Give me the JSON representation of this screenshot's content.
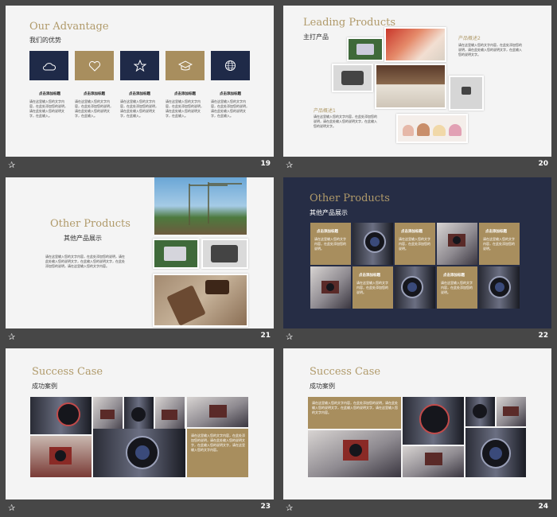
{
  "slides": [
    {
      "number": "19",
      "title": "Our Advantage",
      "subtitle": "我们的优势",
      "icons": [
        "cloud-icon",
        "heart-icon",
        "star-icon",
        "graduation-cap-icon",
        "globe-icon"
      ],
      "column_title": "点击添加标题",
      "body": "请在这里输入您的文字内容，在此处添加您的说明，请在此处输入您的说明文字，在此输入。"
    },
    {
      "number": "20",
      "title": "Leading Products",
      "subtitle": "主打产品",
      "label1": "产品概述2",
      "label2": "产品概述1",
      "body": "请在这里输入您的文字内容，在此处添加您的说明，请在此处输入您的说明文字，在此输入您的说明文字。"
    },
    {
      "number": "21",
      "title": "Other Products",
      "subtitle": "其他产品展示",
      "body": "请在这里输入您的文字内容，在此处添加您的说明，请在此处输入您的说明文字，在此输入您的说明文字，在此处添加您的说明，请在这里输入您的文字内容。"
    },
    {
      "number": "22",
      "title": "Other Products",
      "subtitle": "其他产品展示",
      "card_title": "点击添加标题",
      "card_body": "请在这里输入您的文字内容，在此处添加您的说明。"
    },
    {
      "number": "23",
      "title": "Success Case",
      "subtitle": "成功案例",
      "body": "请在这里输入您的文字内容，在此处添加您的说明，请在此处输入您的说明文字，在此输入您的说明文字，请在这里输入您的文字内容。"
    },
    {
      "number": "24",
      "title": "Success Case",
      "subtitle": "成功案例",
      "body": "请在这里输入您的文字内容，在此处添加您的说明，请在此处输入您的说明文字，在此输入您的说明文字，请在这里输入您的文字内容。"
    }
  ],
  "colors": {
    "navy": "#1f2a48",
    "gold": "#a88e5e",
    "title_gold": "#b09a6a",
    "background": "#474747"
  }
}
